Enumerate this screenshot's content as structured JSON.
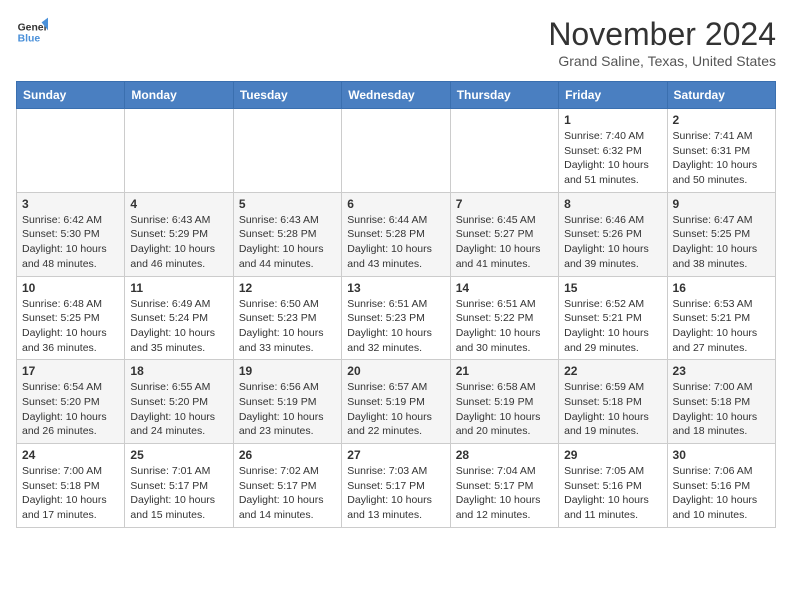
{
  "header": {
    "logo_line1": "General",
    "logo_line2": "Blue",
    "month": "November 2024",
    "location": "Grand Saline, Texas, United States"
  },
  "weekdays": [
    "Sunday",
    "Monday",
    "Tuesday",
    "Wednesday",
    "Thursday",
    "Friday",
    "Saturday"
  ],
  "weeks": [
    [
      {
        "day": "",
        "info": ""
      },
      {
        "day": "",
        "info": ""
      },
      {
        "day": "",
        "info": ""
      },
      {
        "day": "",
        "info": ""
      },
      {
        "day": "",
        "info": ""
      },
      {
        "day": "1",
        "info": "Sunrise: 7:40 AM\nSunset: 6:32 PM\nDaylight: 10 hours\nand 51 minutes."
      },
      {
        "day": "2",
        "info": "Sunrise: 7:41 AM\nSunset: 6:31 PM\nDaylight: 10 hours\nand 50 minutes."
      }
    ],
    [
      {
        "day": "3",
        "info": "Sunrise: 6:42 AM\nSunset: 5:30 PM\nDaylight: 10 hours\nand 48 minutes."
      },
      {
        "day": "4",
        "info": "Sunrise: 6:43 AM\nSunset: 5:29 PM\nDaylight: 10 hours\nand 46 minutes."
      },
      {
        "day": "5",
        "info": "Sunrise: 6:43 AM\nSunset: 5:28 PM\nDaylight: 10 hours\nand 44 minutes."
      },
      {
        "day": "6",
        "info": "Sunrise: 6:44 AM\nSunset: 5:28 PM\nDaylight: 10 hours\nand 43 minutes."
      },
      {
        "day": "7",
        "info": "Sunrise: 6:45 AM\nSunset: 5:27 PM\nDaylight: 10 hours\nand 41 minutes."
      },
      {
        "day": "8",
        "info": "Sunrise: 6:46 AM\nSunset: 5:26 PM\nDaylight: 10 hours\nand 39 minutes."
      },
      {
        "day": "9",
        "info": "Sunrise: 6:47 AM\nSunset: 5:25 PM\nDaylight: 10 hours\nand 38 minutes."
      }
    ],
    [
      {
        "day": "10",
        "info": "Sunrise: 6:48 AM\nSunset: 5:25 PM\nDaylight: 10 hours\nand 36 minutes."
      },
      {
        "day": "11",
        "info": "Sunrise: 6:49 AM\nSunset: 5:24 PM\nDaylight: 10 hours\nand 35 minutes."
      },
      {
        "day": "12",
        "info": "Sunrise: 6:50 AM\nSunset: 5:23 PM\nDaylight: 10 hours\nand 33 minutes."
      },
      {
        "day": "13",
        "info": "Sunrise: 6:51 AM\nSunset: 5:23 PM\nDaylight: 10 hours\nand 32 minutes."
      },
      {
        "day": "14",
        "info": "Sunrise: 6:51 AM\nSunset: 5:22 PM\nDaylight: 10 hours\nand 30 minutes."
      },
      {
        "day": "15",
        "info": "Sunrise: 6:52 AM\nSunset: 5:21 PM\nDaylight: 10 hours\nand 29 minutes."
      },
      {
        "day": "16",
        "info": "Sunrise: 6:53 AM\nSunset: 5:21 PM\nDaylight: 10 hours\nand 27 minutes."
      }
    ],
    [
      {
        "day": "17",
        "info": "Sunrise: 6:54 AM\nSunset: 5:20 PM\nDaylight: 10 hours\nand 26 minutes."
      },
      {
        "day": "18",
        "info": "Sunrise: 6:55 AM\nSunset: 5:20 PM\nDaylight: 10 hours\nand 24 minutes."
      },
      {
        "day": "19",
        "info": "Sunrise: 6:56 AM\nSunset: 5:19 PM\nDaylight: 10 hours\nand 23 minutes."
      },
      {
        "day": "20",
        "info": "Sunrise: 6:57 AM\nSunset: 5:19 PM\nDaylight: 10 hours\nand 22 minutes."
      },
      {
        "day": "21",
        "info": "Sunrise: 6:58 AM\nSunset: 5:19 PM\nDaylight: 10 hours\nand 20 minutes."
      },
      {
        "day": "22",
        "info": "Sunrise: 6:59 AM\nSunset: 5:18 PM\nDaylight: 10 hours\nand 19 minutes."
      },
      {
        "day": "23",
        "info": "Sunrise: 7:00 AM\nSunset: 5:18 PM\nDaylight: 10 hours\nand 18 minutes."
      }
    ],
    [
      {
        "day": "24",
        "info": "Sunrise: 7:00 AM\nSunset: 5:18 PM\nDaylight: 10 hours\nand 17 minutes."
      },
      {
        "day": "25",
        "info": "Sunrise: 7:01 AM\nSunset: 5:17 PM\nDaylight: 10 hours\nand 15 minutes."
      },
      {
        "day": "26",
        "info": "Sunrise: 7:02 AM\nSunset: 5:17 PM\nDaylight: 10 hours\nand 14 minutes."
      },
      {
        "day": "27",
        "info": "Sunrise: 7:03 AM\nSunset: 5:17 PM\nDaylight: 10 hours\nand 13 minutes."
      },
      {
        "day": "28",
        "info": "Sunrise: 7:04 AM\nSunset: 5:17 PM\nDaylight: 10 hours\nand 12 minutes."
      },
      {
        "day": "29",
        "info": "Sunrise: 7:05 AM\nSunset: 5:16 PM\nDaylight: 10 hours\nand 11 minutes."
      },
      {
        "day": "30",
        "info": "Sunrise: 7:06 AM\nSunset: 5:16 PM\nDaylight: 10 hours\nand 10 minutes."
      }
    ]
  ]
}
